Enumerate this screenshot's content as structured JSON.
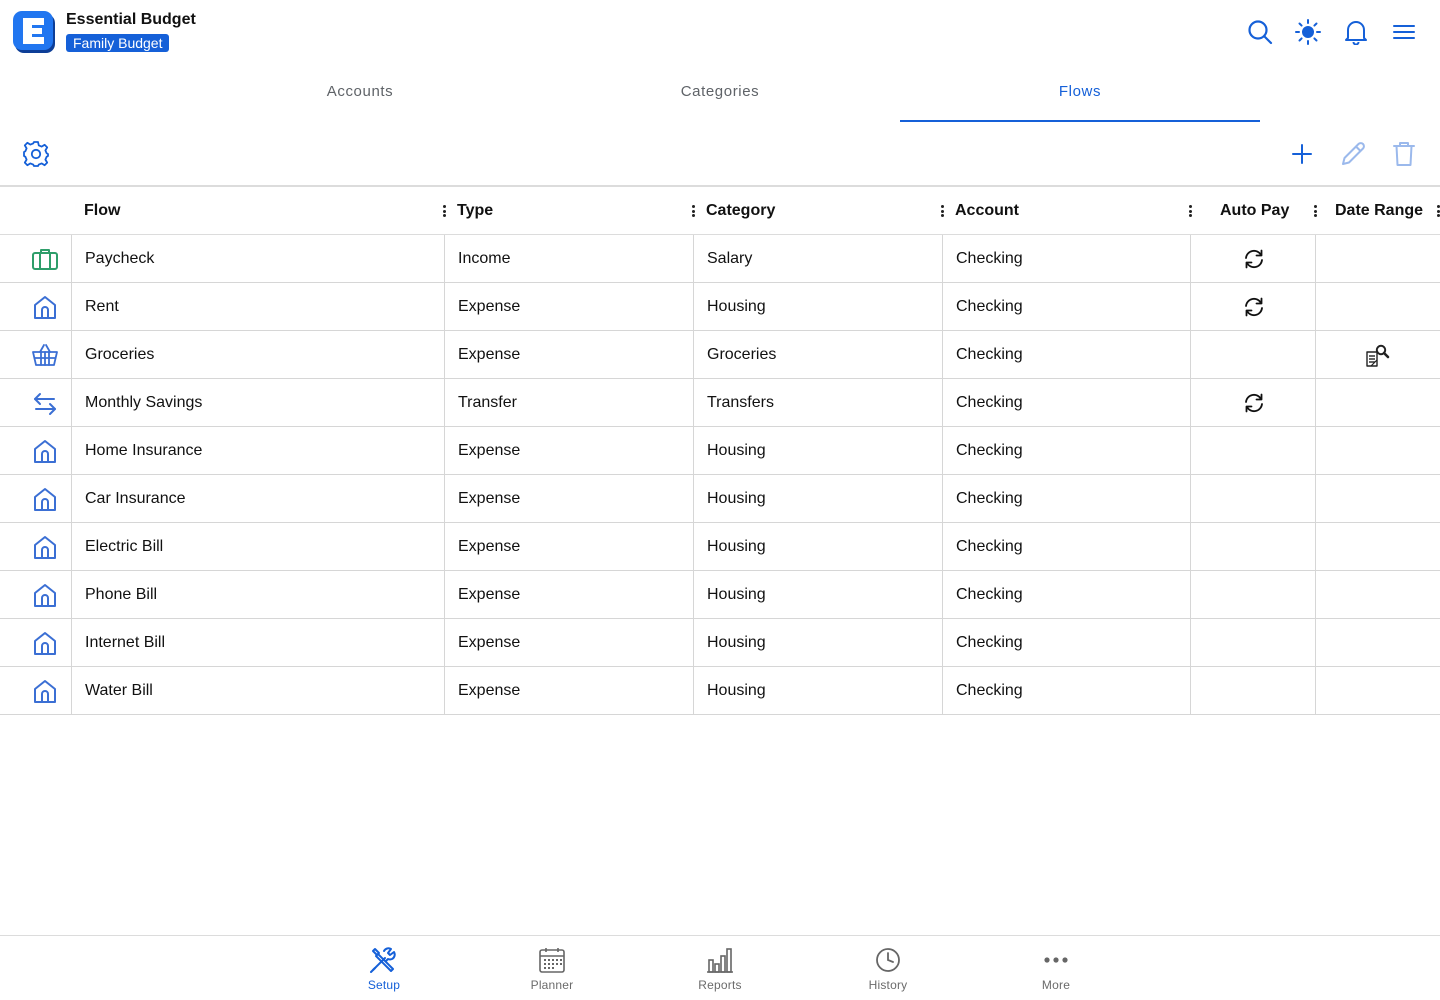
{
  "app": {
    "title": "Essential Budget",
    "budget_name": "Family Budget"
  },
  "header_icons": [
    "search-icon",
    "brightness-icon",
    "bell-icon",
    "menu-icon"
  ],
  "tabs": [
    {
      "label": "Accounts",
      "active": false
    },
    {
      "label": "Categories",
      "active": false
    },
    {
      "label": "Flows",
      "active": true
    }
  ],
  "toolbar": {
    "left": [
      "settings-icon"
    ],
    "right": [
      "add-icon",
      "edit-icon",
      "delete-icon"
    ]
  },
  "columns": [
    "Flow",
    "Type",
    "Category",
    "Account",
    "Auto Pay",
    "Date Range"
  ],
  "rows": [
    {
      "icon": "briefcase-icon",
      "flow": "Paycheck",
      "type": "Income",
      "category": "Salary",
      "account": "Checking",
      "auto_pay": true,
      "date_range": false
    },
    {
      "icon": "house-icon",
      "flow": "Rent",
      "type": "Expense",
      "category": "Housing",
      "account": "Checking",
      "auto_pay": true,
      "date_range": false
    },
    {
      "icon": "basket-icon",
      "flow": "Groceries",
      "type": "Expense",
      "category": "Groceries",
      "account": "Checking",
      "auto_pay": false,
      "date_range": true
    },
    {
      "icon": "transfer-icon",
      "flow": "Monthly Savings",
      "type": "Transfer",
      "category": "Transfers",
      "account": "Checking",
      "auto_pay": true,
      "date_range": false
    },
    {
      "icon": "house-icon",
      "flow": "Home Insurance",
      "type": "Expense",
      "category": "Housing",
      "account": "Checking",
      "auto_pay": false,
      "date_range": false
    },
    {
      "icon": "house-icon",
      "flow": "Car Insurance",
      "type": "Expense",
      "category": "Housing",
      "account": "Checking",
      "auto_pay": false,
      "date_range": false
    },
    {
      "icon": "house-icon",
      "flow": "Electric Bill",
      "type": "Expense",
      "category": "Housing",
      "account": "Checking",
      "auto_pay": false,
      "date_range": false
    },
    {
      "icon": "house-icon",
      "flow": "Phone Bill",
      "type": "Expense",
      "category": "Housing",
      "account": "Checking",
      "auto_pay": false,
      "date_range": false
    },
    {
      "icon": "house-icon",
      "flow": "Internet Bill",
      "type": "Expense",
      "category": "Housing",
      "account": "Checking",
      "auto_pay": false,
      "date_range": false
    },
    {
      "icon": "house-icon",
      "flow": "Water Bill",
      "type": "Expense",
      "category": "Housing",
      "account": "Checking",
      "auto_pay": false,
      "date_range": false
    }
  ],
  "bottom_nav": [
    {
      "label": "Setup",
      "icon": "tools-icon",
      "active": true
    },
    {
      "label": "Planner",
      "icon": "calendar-icon",
      "active": false
    },
    {
      "label": "Reports",
      "icon": "bar-chart-icon",
      "active": false
    },
    {
      "label": "History",
      "icon": "clock-icon",
      "active": false
    },
    {
      "label": "More",
      "icon": "more-icon",
      "active": false
    }
  ],
  "colors": {
    "accent": "#1560d8",
    "icon_blue": "#3b6fd4",
    "icon_green": "#2e9e6a",
    "border": "#dcdcdc",
    "muted": "#6b6b6b"
  }
}
